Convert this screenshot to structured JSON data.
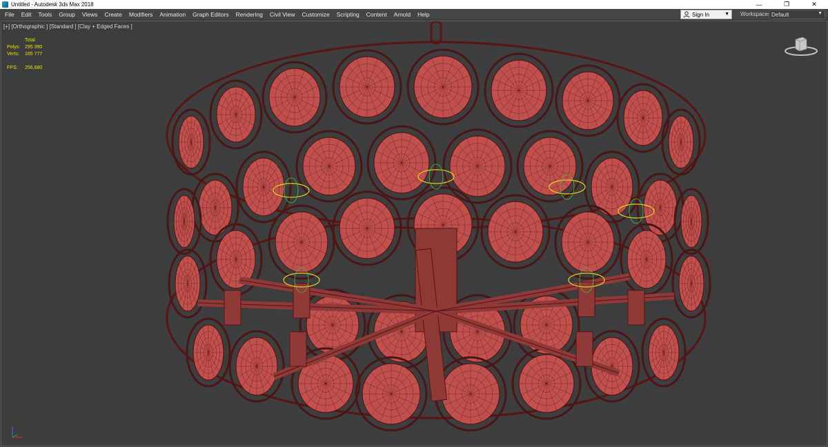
{
  "window": {
    "title": "Untitled - Autodesk 3ds Max 2018",
    "controls": {
      "minimize": "—",
      "maximize": "❐",
      "close": "✕"
    }
  },
  "menu": [
    {
      "label": "File"
    },
    {
      "label": "Edit"
    },
    {
      "label": "Tools"
    },
    {
      "label": "Group"
    },
    {
      "label": "Views"
    },
    {
      "label": "Create"
    },
    {
      "label": "Modifiers"
    },
    {
      "label": "Animation"
    },
    {
      "label": "Graph Editors"
    },
    {
      "label": "Rendering"
    },
    {
      "label": "Civil View"
    },
    {
      "label": "Customize"
    },
    {
      "label": "Scripting"
    },
    {
      "label": "Content"
    },
    {
      "label": "Arnold"
    },
    {
      "label": "Help"
    }
  ],
  "account": {
    "signin_label": "Sign In",
    "caret": "▼"
  },
  "workspaces": {
    "label": "Workspaces:",
    "value": "Default",
    "caret": "▼"
  },
  "viewport": {
    "label": "[+] [Orthographic ] [Standard ] [Clay + Edged Faces ]",
    "stats": {
      "header": "Total",
      "polys_label": "Polys:",
      "polys": "295 390",
      "verts_label": "Verts:",
      "verts": "165 777",
      "fps_label": "FPS:",
      "fps": "256,680"
    }
  },
  "colors": {
    "model_fill": "#c0504d",
    "model_wire": "#5a1414",
    "stat_text": "#e8e000",
    "light_gizmo": "#e0d020",
    "viewport_bg": "#3d3d3d"
  },
  "icons": [
    "app-icon",
    "user-icon",
    "viewcube-icon",
    "axis-tripod-icon"
  ]
}
